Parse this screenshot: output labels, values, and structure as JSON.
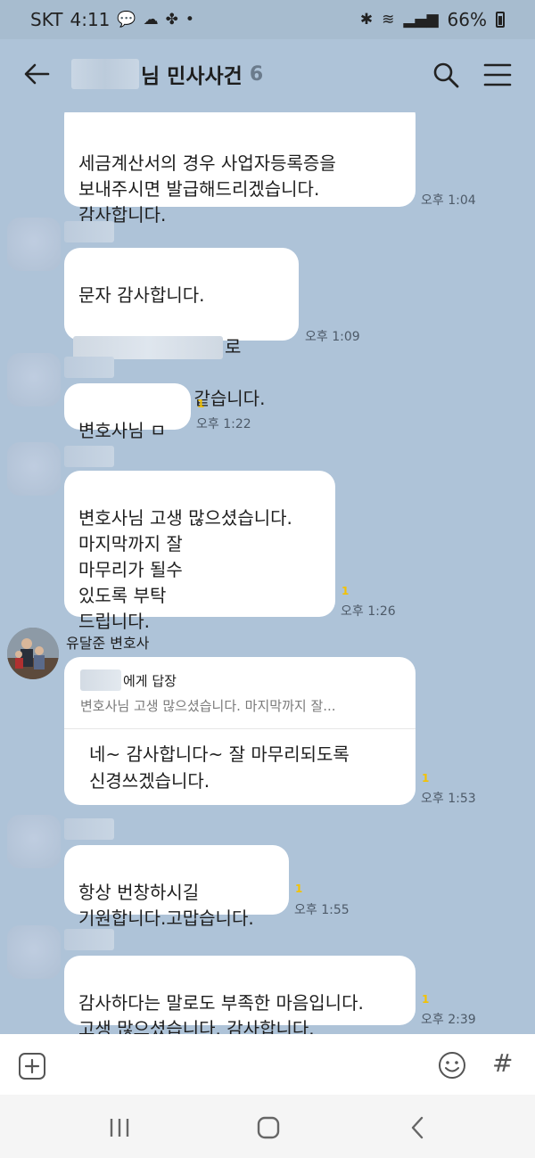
{
  "status_bar": {
    "carrier": "SKT",
    "time": "4:11",
    "battery": "66%"
  },
  "header": {
    "title": "님 민사사건",
    "member_count": "6"
  },
  "messages": {
    "m1": {
      "text": "세금계산서의 경우 사업자등록증을\n보내주시면 발급해드리겠습니다.\n감사합니다.",
      "time": "오후 1:04"
    },
    "m2": {
      "line1": "문자 감사합니다.",
      "line2_suffix": "로",
      "line3": "해 주시면 될것 같습니다.",
      "time": "오후 1:09"
    },
    "m3": {
      "text": "변호사님 ㅁ",
      "unread": "1",
      "time": "오후 1:22"
    },
    "m4": {
      "text": "변호사님 고생 많으셨습니다.\n마지막까지 잘\n마무리가 될수\n있도록 부탁\n드립니다.",
      "unread": "1",
      "time": "오후 1:26"
    },
    "m5": {
      "sender": "유달준 변호사",
      "reply_to_suffix": "에게 답장",
      "quote": "변호사님 고생 많으셨습니다. 마지막까지 잘...",
      "text": "네~ 감사합니다~ 잘 마무리되도록\n신경쓰겠습니다.",
      "unread": "1",
      "time": "오후 1:53"
    },
    "m6": {
      "text": "항상 번창하시길\n기원합니다.고맙습니다.",
      "unread": "1",
      "time": "오후 1:55"
    },
    "m7": {
      "text": "감사하다는 말로도 부족한 마음입니다.\n고생 많으셨습니다. 감사합니다.",
      "unread": "1",
      "time": "오후 2:39"
    }
  },
  "icons": {
    "back": "back-arrow-icon",
    "search": "search-icon",
    "menu": "menu-icon",
    "plus": "plus-icon",
    "emoji": "emoji-icon",
    "hash": "#"
  },
  "colors": {
    "chat_background": "#aec3d8",
    "bubble": "#ffffff",
    "unread_badge": "#f4c200"
  }
}
